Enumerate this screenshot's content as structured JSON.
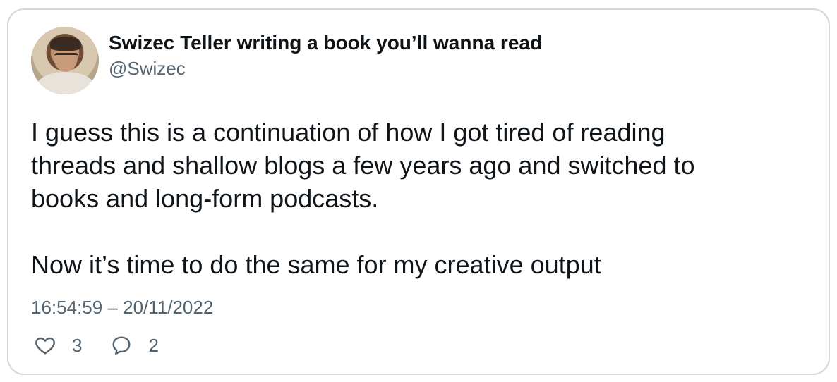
{
  "tweet": {
    "display_name": "Swizec Teller writing a book you’ll wanna read",
    "handle": "@Swizec",
    "text": "I guess this is a continuation of how I got tired of reading\nthreads and shallow blogs a few years ago and switched to\nbooks and long-form podcasts.\n\nNow it’s time to do the same for my creative output",
    "timestamp": "16:54:59 – 20/11/2022",
    "likes": "3",
    "replies": "2"
  },
  "colors": {
    "border": "#cfd9de",
    "muted": "#536471",
    "text": "#0f1419"
  },
  "icons": {
    "like": "heart-icon",
    "reply": "speech-bubble-icon"
  }
}
